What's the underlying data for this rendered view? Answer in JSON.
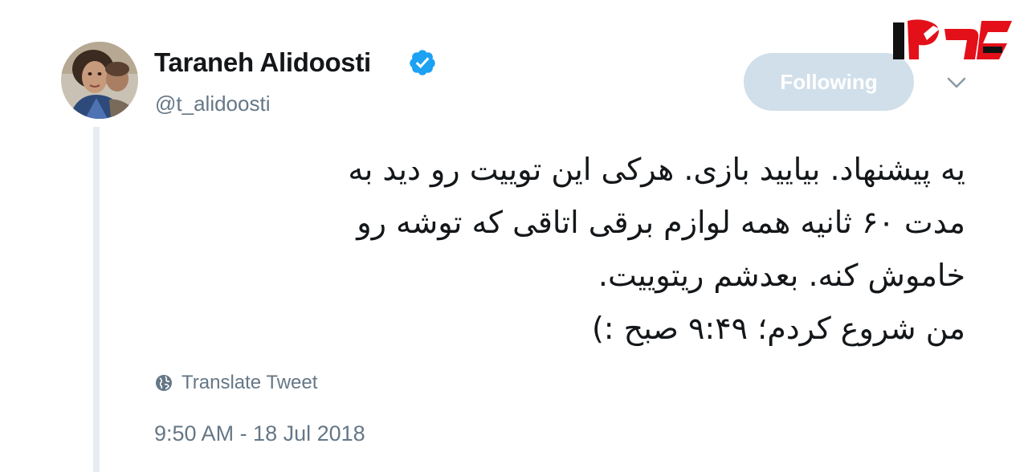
{
  "tweet": {
    "author_name": "Taraneh Alidoosti",
    "author_handle": "@t_alidoosti",
    "verified": true,
    "follow_button_label": "Following",
    "text_lines": [
      "یه پیشنهاد. بیایید بازی. هرکی این توییت رو دید به",
      "مدت ۶۰ ثانیه همه لوازم برقی اتاقی که توشه رو",
      "خاموش کنه. بعدشم ریتوییت.",
      "من شروع کردم؛ ۹:۴۹ صبح :)"
    ],
    "translate_label": "Translate Tweet",
    "timestamp": "9:50 AM - 18 Jul 2018"
  },
  "icons": {
    "verified": "verified-badge-icon",
    "menu": "chevron-down-icon",
    "translate": "globe-icon",
    "site_logo": "site-logo"
  },
  "colors": {
    "verified_blue": "#1da1f2",
    "following_button_bg": "#d0dfea",
    "secondary_text": "#657786",
    "logo_red": "#e3101a",
    "logo_dark": "#111111"
  }
}
